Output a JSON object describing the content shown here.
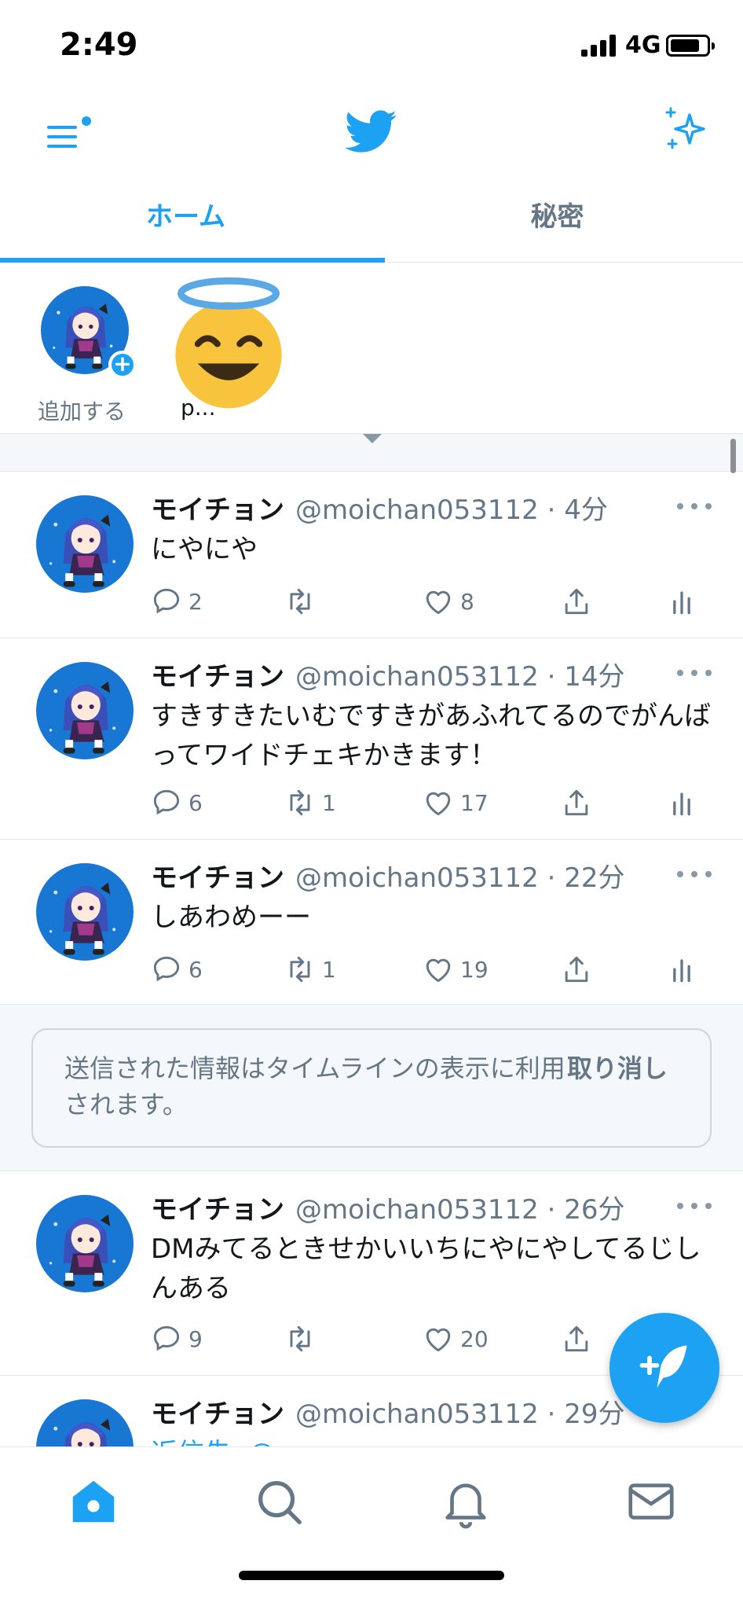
{
  "status_bar": {
    "time": "2:49",
    "network": "4G"
  },
  "header": {
    "menu_icon": "hamburger-menu-icon",
    "logo_icon": "twitter-bird-icon",
    "sparkle_icon": "sparkle-icon"
  },
  "tabs": [
    {
      "label": "ホーム",
      "active": true
    },
    {
      "label": "秘密",
      "active": false
    }
  ],
  "fleets": {
    "add_label": "追加する",
    "other_label": "p..."
  },
  "tweets": [
    {
      "name": "モイチョン",
      "handle": "@moichan053112",
      "time": "· 4分",
      "text": "にやにや",
      "replies": "2",
      "retweets": "",
      "likes": "8"
    },
    {
      "name": "モイチョン",
      "handle": "@moichan053112",
      "time": "· 14分",
      "text": "すきすきたいむですきがあふれてるのでがんばってワイドチェキかきます！",
      "replies": "6",
      "retweets": "1",
      "likes": "17"
    },
    {
      "name": "モイチョン",
      "handle": "@moichan053112",
      "time": "· 22分",
      "text": "しあわめーー",
      "replies": "6",
      "retweets": "1",
      "likes": "19"
    },
    {
      "name": "モイチョン",
      "handle": "@moichan053112",
      "time": "· 26分",
      "text": "DMみてるときせかいいちにやにやしてるじしんある",
      "replies": "9",
      "retweets": "",
      "likes": "20"
    },
    {
      "name": "モイチョン",
      "handle": "@moichan053112",
      "time": "· 29分",
      "text": "返信先: @...",
      "replies": "",
      "retweets": "",
      "likes": ""
    }
  ],
  "info_banner": {
    "text": "送信された情報はタイムラインの表示に利用されます。",
    "undo_label": "取り消し"
  },
  "colors": {
    "accent": "#1da1f2",
    "secondary_text": "#657786",
    "divider": "#e1e8ed",
    "background_gray": "#f5f8fa"
  },
  "bottom_nav": [
    "home-icon",
    "search-icon",
    "notifications-bell-icon",
    "messages-envelope-icon"
  ]
}
